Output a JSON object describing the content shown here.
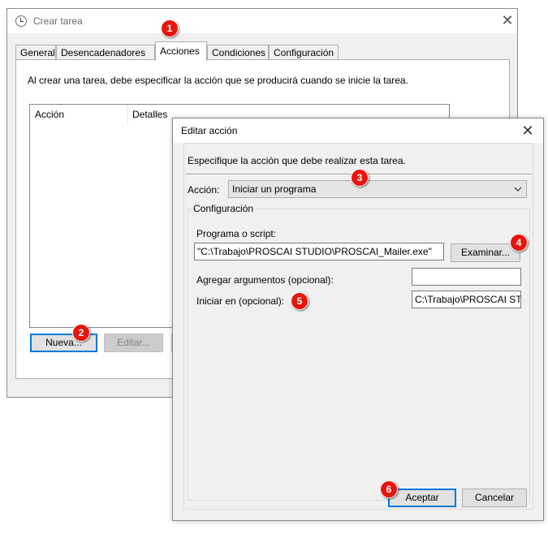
{
  "background_window": {
    "title": "Crear tarea",
    "tabs": [
      "General",
      "Desencadenadores",
      "Acciones",
      "Condiciones",
      "Configuración"
    ],
    "active_tab": "Acciones",
    "description": "Al crear una tarea, debe especificar la acción que se producirá cuando se inicie la tarea.",
    "list_columns": [
      "Acción",
      "Detalles"
    ],
    "buttons": {
      "new": "Nueva...",
      "edit": "Editar..."
    }
  },
  "dialog": {
    "title": "Editar acción",
    "description": "Especifique la acción que debe realizar esta tarea.",
    "action_label": "Acción:",
    "action_value": "Iniciar un programa",
    "group_label": "Configuración",
    "program_label": "Programa o script:",
    "program_value": "\"C:\\Trabajo\\PROSCAI STUDIO\\PROSCAI_Mailer.exe\"",
    "browse_button": "Examinar...",
    "arguments_label": "Agregar argumentos (opcional):",
    "arguments_value": "",
    "start_in_label": "Iniciar en (opcional):",
    "start_in_value": "C:\\Trabajo\\PROSCAI ST",
    "ok_button": "Aceptar",
    "cancel_button": "Cancelar"
  },
  "callouts": [
    "1",
    "2",
    "3",
    "4",
    "5",
    "6"
  ],
  "colors": {
    "callout": "#e8150d",
    "focus_border": "#0078d7",
    "window_bg": "#f0f0f0"
  }
}
